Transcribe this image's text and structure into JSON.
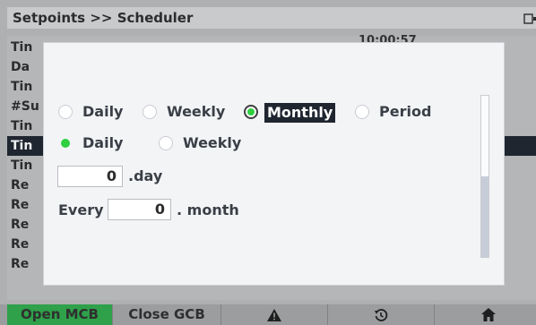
{
  "header": {
    "title": "Setpoints >> Scheduler"
  },
  "background_list": {
    "rows": [
      "Tin",
      "Da",
      "Tin",
      "#Su",
      "Tin",
      "Tin",
      "Tin",
      "Re",
      "Re",
      "Re",
      "Re",
      "Re"
    ],
    "value_fragment": "10:00:57"
  },
  "dialog": {
    "repeat_options": [
      {
        "label": "Daily",
        "checked": false
      },
      {
        "label": "Weekly",
        "checked": false
      },
      {
        "label": "Monthly",
        "checked": true
      },
      {
        "label": "Period",
        "checked": false
      }
    ],
    "monthly_options": [
      {
        "label": "Daily",
        "checked": true
      },
      {
        "label": "Weekly",
        "checked": false
      }
    ],
    "day_value": "0",
    "day_unit": ".day",
    "every_label": "Every",
    "month_value": "0",
    "month_unit": ". month"
  },
  "bottom_bar": {
    "open_mcb": "Open MCB",
    "close_gcb": "Close GCB",
    "alarm_icon": "warning-icon",
    "history_icon": "history-icon",
    "home_icon": "home-icon",
    "accent_green": "#2ea14a"
  }
}
